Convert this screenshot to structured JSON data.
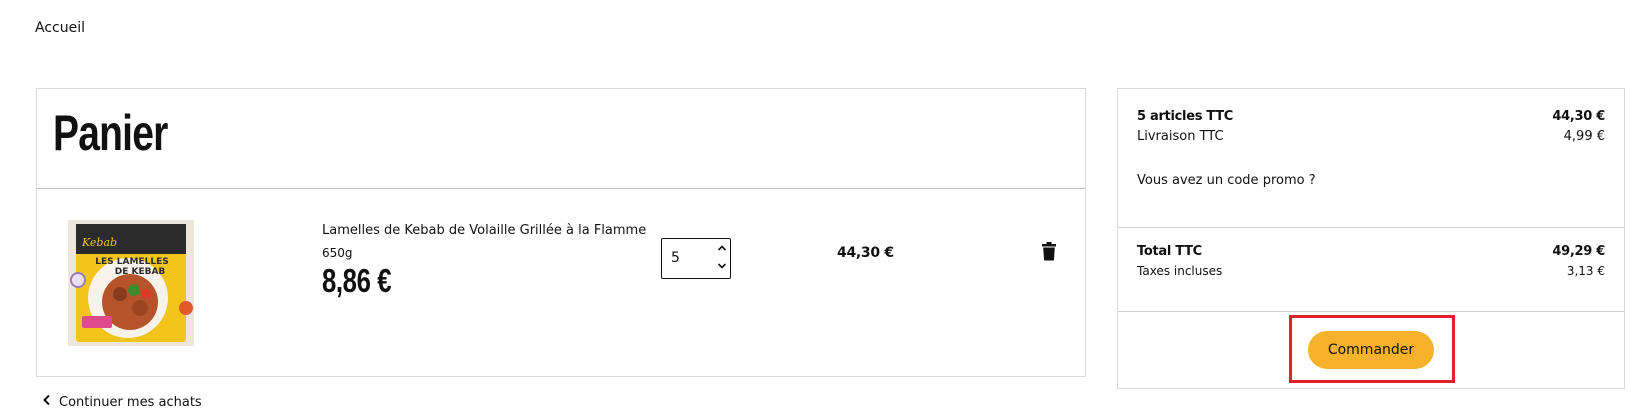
{
  "breadcrumb": {
    "home": "Accueil"
  },
  "cart": {
    "title": "Panier",
    "items": [
      {
        "name": "Lamelles de Kebab de Volaille Grillée à la Flamme",
        "weight": "650g",
        "unit_price": "8,86 €",
        "quantity": "5",
        "line_total": "44,30 €",
        "image_text": {
          "brand": "Kebab",
          "line1": "LES LAMELLES",
          "line2": "DE KEBAB"
        }
      }
    ],
    "continue_label": "Continuer mes achats"
  },
  "summary": {
    "articles_label": "5 articles TTC",
    "articles_value": "44,30 €",
    "delivery_label": "Livraison TTC",
    "delivery_value": "4,99 €",
    "promo_label": "Vous avez un code promo ?",
    "total_label": "Total TTC",
    "total_value": "49,29 €",
    "tax_label": "Taxes incluses",
    "tax_value": "3,13 €",
    "order_button": "Commander"
  },
  "colors": {
    "accent": "#f5b22a",
    "highlight": "#e0202b",
    "border": "#d9d9d9"
  }
}
